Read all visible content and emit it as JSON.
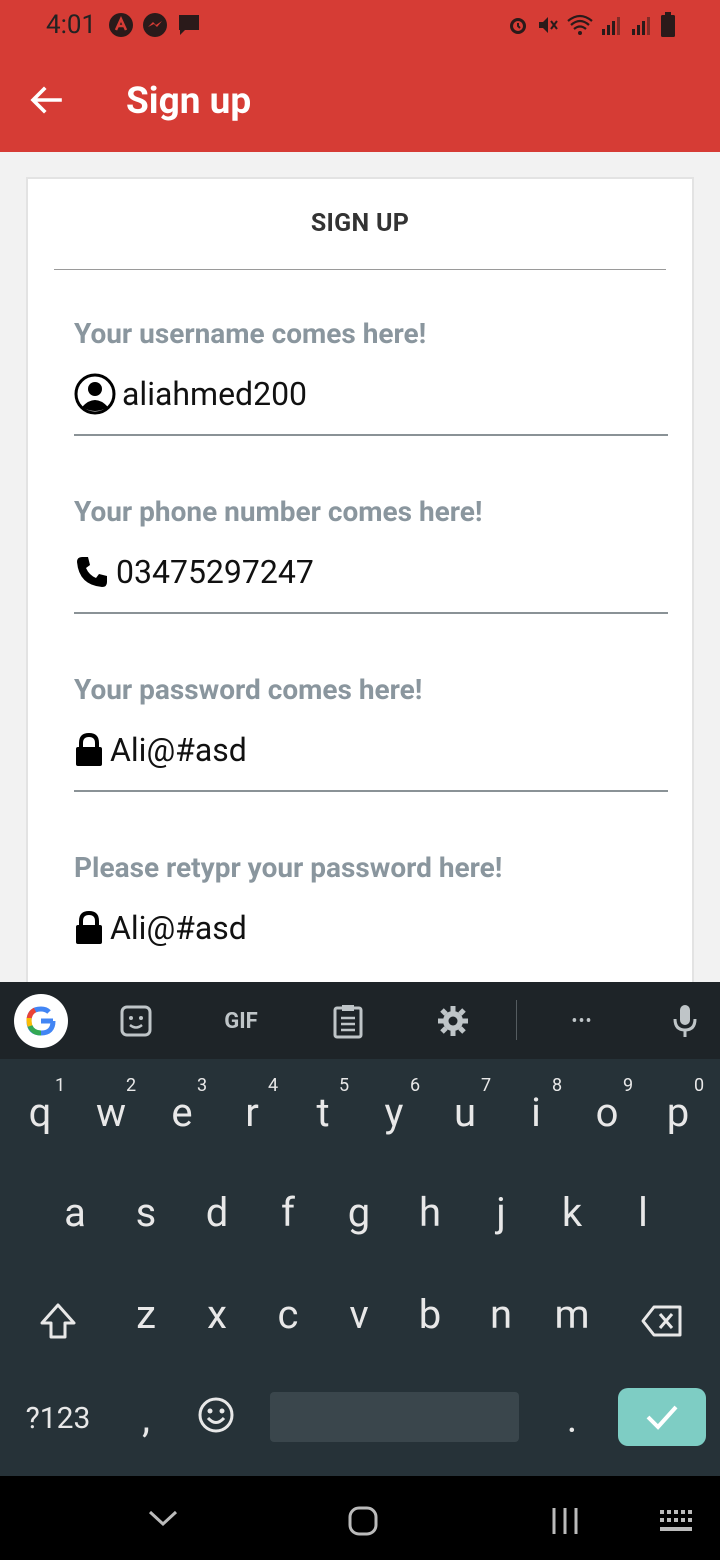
{
  "status": {
    "time": "4:01"
  },
  "appbar": {
    "title": "Sign up"
  },
  "card": {
    "title": "SIGN UP"
  },
  "fields": [
    {
      "label": "Your username comes here!",
      "value": "aliahmed200",
      "icon": "user-circle-icon"
    },
    {
      "label": "Your phone number comes here!",
      "value": "03475297247",
      "icon": "phone-icon"
    },
    {
      "label": "Your password comes here!",
      "value": "Ali@#asd",
      "icon": "lock-icon"
    },
    {
      "label": "Please retypr your password here!",
      "value": "Ali@#asd",
      "icon": "lock-icon"
    }
  ],
  "keyboard": {
    "toolbar": {
      "gif_label": "GIF",
      "more_label": "•••"
    },
    "row1": [
      "q",
      "w",
      "e",
      "r",
      "t",
      "y",
      "u",
      "i",
      "o",
      "p"
    ],
    "row1_hints": [
      "1",
      "2",
      "3",
      "4",
      "5",
      "6",
      "7",
      "8",
      "9",
      "0"
    ],
    "row2": [
      "a",
      "s",
      "d",
      "f",
      "g",
      "h",
      "j",
      "k",
      "l"
    ],
    "row3": [
      "z",
      "x",
      "c",
      "v",
      "b",
      "n",
      "m"
    ],
    "symbols_label": "?123",
    "comma": ",",
    "period": "."
  },
  "colors": {
    "accent": "#d63c35",
    "keyboard_bg": "#263238",
    "enter_key": "#7ecdc4"
  }
}
